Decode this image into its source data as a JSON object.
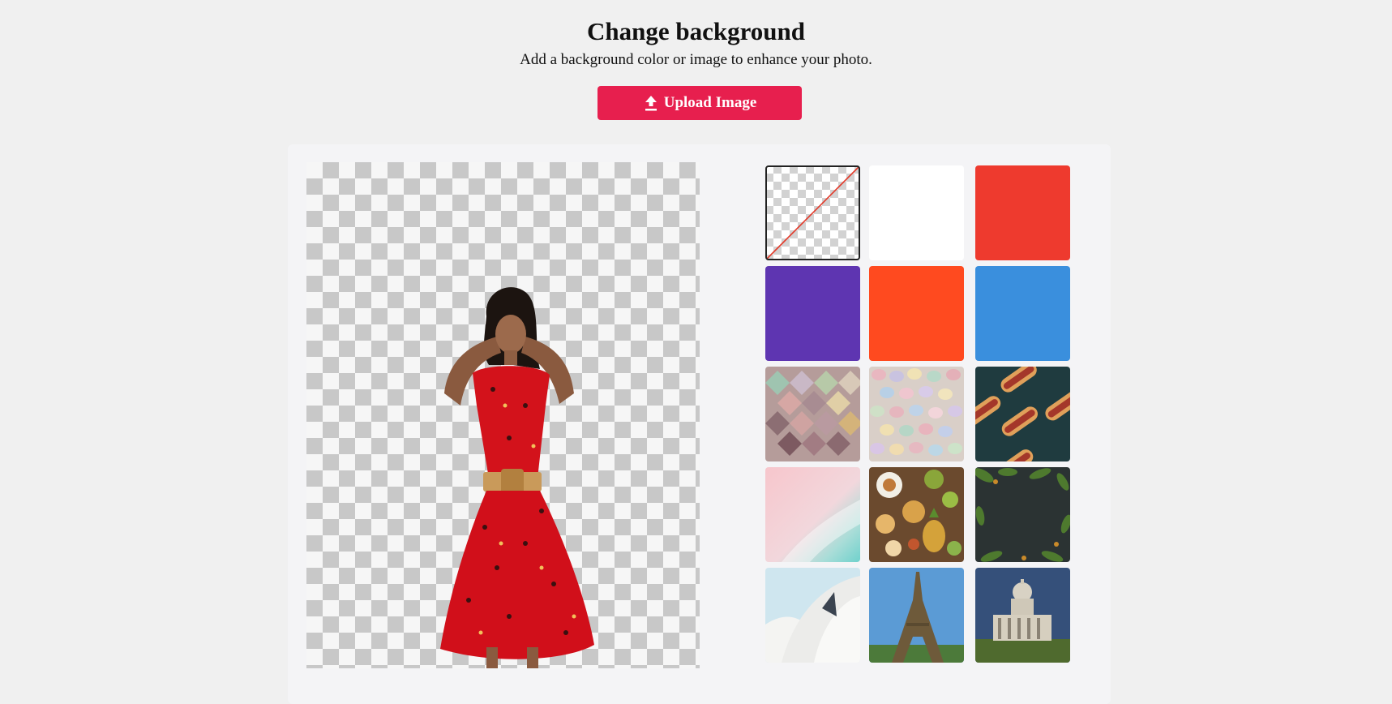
{
  "header": {
    "title": "Change background",
    "subtitle": "Add a background color or image to enhance your photo.",
    "upload_label": "Upload Image"
  },
  "preview": {
    "subject": "woman in red floral dress with gold belt",
    "background": "transparent"
  },
  "swatches": [
    {
      "kind": "transparent",
      "selected": true
    },
    {
      "kind": "color",
      "color": "#ffffff"
    },
    {
      "kind": "color",
      "color": "#ee3a2e"
    },
    {
      "kind": "color",
      "color": "#5e35b1"
    },
    {
      "kind": "color",
      "color": "#ff4a1f"
    },
    {
      "kind": "color",
      "color": "#3a8fdd"
    },
    {
      "kind": "image",
      "subject": "pastel diamond tiles"
    },
    {
      "kind": "image",
      "subject": "pastel candy eggs"
    },
    {
      "kind": "image",
      "subject": "hot dogs on dark teal"
    },
    {
      "kind": "image",
      "subject": "pink and teal pastel gradient"
    },
    {
      "kind": "image",
      "subject": "food spread with pineapple"
    },
    {
      "kind": "image",
      "subject": "dark board with foliage border"
    },
    {
      "kind": "image",
      "subject": "white sail roof architecture"
    },
    {
      "kind": "image",
      "subject": "eiffel tower"
    },
    {
      "kind": "image",
      "subject": "domed monument building"
    }
  ]
}
